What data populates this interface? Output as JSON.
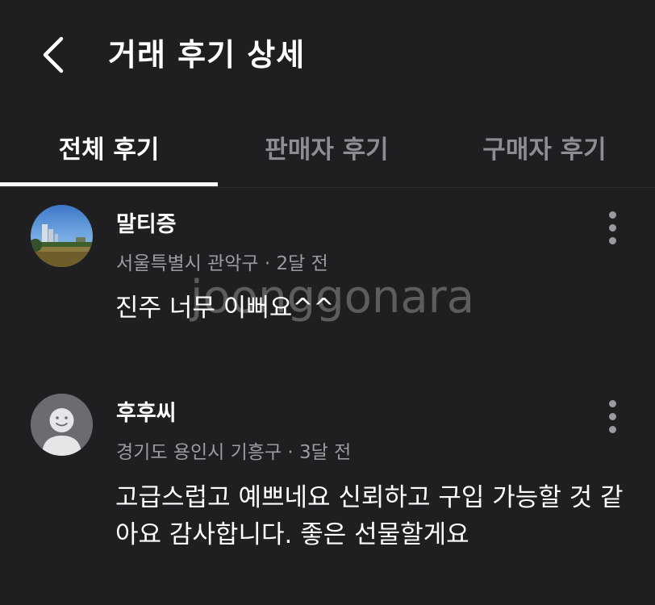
{
  "header": {
    "title": "거래 후기 상세",
    "back_icon": "chevron-left-icon"
  },
  "tabs": [
    {
      "label": "전체 후기",
      "active": true
    },
    {
      "label": "판매자 후기",
      "active": false
    },
    {
      "label": "구매자 후기",
      "active": false
    }
  ],
  "reviews": [
    {
      "nickname": "말티증",
      "meta": "서울특별시 관악구 · 2달 전",
      "content": "진주 너무 이뻐요^^",
      "avatar": "landscape-photo"
    },
    {
      "nickname": "후후씨",
      "meta": "경기도 용인시 기흥구 · 3달 전",
      "content": "고급스럽고 예쁘네요 신뢰하고 구입 가능할 것 같아요 감사합니다. 좋은 선물할게요",
      "avatar": "default-smiley-avatar"
    }
  ],
  "watermark": "joonggonara",
  "colors": {
    "background": "#1f1f22",
    "text": "#ffffff",
    "muted": "#9b9ba1",
    "inactive_tab": "#8d8d93"
  }
}
